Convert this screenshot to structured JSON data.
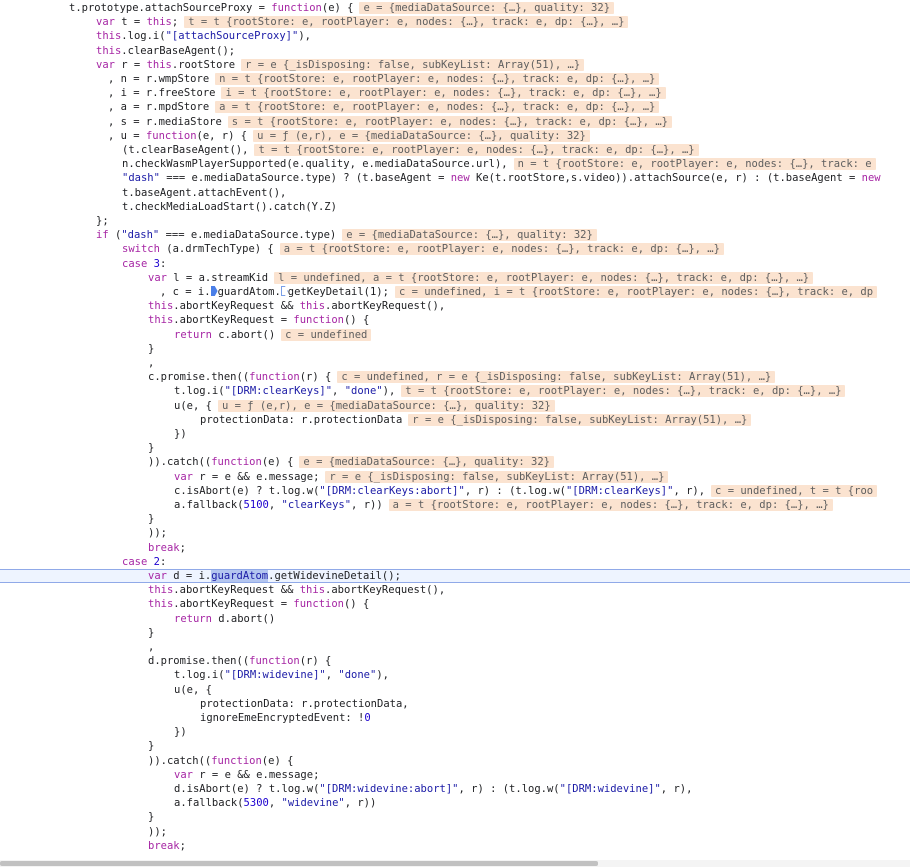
{
  "editor": {
    "lines": [
      {
        "indent": 69,
        "segs": [
          [
            "plain",
            "t.prototype.attachSourceProxy = "
          ],
          [
            "kw",
            "function"
          ],
          [
            "plain",
            "(e) {"
          ]
        ],
        "val": "e = {mediaDataSource: {…}, quality: 32}"
      },
      {
        "indent": 96,
        "segs": [
          [
            "kw",
            "var"
          ],
          [
            "plain",
            " t = "
          ],
          [
            "this",
            "this"
          ],
          [
            "plain",
            ";"
          ]
        ],
        "val": "t = t {rootStore: e, rootPlayer: e, nodes: {…}, track: e, dp: {…}, …}"
      },
      {
        "indent": 96,
        "segs": [
          [
            "this",
            "this"
          ],
          [
            "plain",
            ".log.i("
          ],
          [
            "str",
            "\"[attachSourceProxy]\""
          ],
          [
            "plain",
            "),"
          ]
        ]
      },
      {
        "indent": 96,
        "segs": [
          [
            "this",
            "this"
          ],
          [
            "plain",
            ".clearBaseAgent();"
          ]
        ]
      },
      {
        "indent": 96,
        "segs": [
          [
            "kw",
            "var"
          ],
          [
            "plain",
            " r = "
          ],
          [
            "this",
            "this"
          ],
          [
            "plain",
            ".rootStore"
          ]
        ],
        "val": "r = e {_isDisposing: false, subKeyList: Array(51), …}"
      },
      {
        "indent": 108,
        "segs": [
          [
            "plain",
            ", n = r.wmpStore"
          ]
        ],
        "val": "n = t {rootStore: e, rootPlayer: e, nodes: {…}, track: e, dp: {…}, …}"
      },
      {
        "indent": 108,
        "segs": [
          [
            "plain",
            ", i = r.freeStore"
          ]
        ],
        "val": "i = t {rootStore: e, rootPlayer: e, nodes: {…}, track: e, dp: {…}, …}"
      },
      {
        "indent": 108,
        "segs": [
          [
            "plain",
            ", a = r.mpdStore"
          ]
        ],
        "val": "a = t {rootStore: e, rootPlayer: e, nodes: {…}, track: e, dp: {…}, …}"
      },
      {
        "indent": 108,
        "segs": [
          [
            "plain",
            ", s = r.mediaStore"
          ]
        ],
        "val": "s = t {rootStore: e, rootPlayer: e, nodes: {…}, track: e, dp: {…}, …}"
      },
      {
        "indent": 108,
        "segs": [
          [
            "plain",
            ", u = "
          ],
          [
            "kw",
            "function"
          ],
          [
            "plain",
            "(e, r) {"
          ]
        ],
        "val": "u = ƒ (e,r), e = {mediaDataSource: {…}, quality: 32}"
      },
      {
        "indent": 122,
        "segs": [
          [
            "plain",
            "(t.clearBaseAgent(),"
          ]
        ],
        "val": "t = t {rootStore: e, rootPlayer: e, nodes: {…}, track: e, dp: {…}, …}"
      },
      {
        "indent": 122,
        "segs": [
          [
            "plain",
            "n.checkWasmPlayerSupported(e.quality, e.mediaDataSource.url),"
          ]
        ],
        "val": "n = t {rootStore: e, rootPlayer: e, nodes: {…}, track: e"
      },
      {
        "indent": 122,
        "segs": [
          [
            "str",
            "\"dash\""
          ],
          [
            "plain",
            " === e.mediaDataSource.type) ? (t.baseAgent = "
          ],
          [
            "kw",
            "new"
          ],
          [
            "plain",
            " Ke(t.rootStore,s.video)).attachSource(e, r) : (t.baseAgent = "
          ],
          [
            "kw",
            "new"
          ]
        ]
      },
      {
        "indent": 122,
        "segs": [
          [
            "plain",
            "t.baseAgent.attachEvent(),"
          ]
        ]
      },
      {
        "indent": 122,
        "segs": [
          [
            "plain",
            "t.checkMediaLoadStart().catch(Y.Z)"
          ]
        ]
      },
      {
        "indent": 96,
        "segs": [
          [
            "plain",
            "};"
          ]
        ]
      },
      {
        "indent": 96,
        "segs": [
          [
            "kw",
            "if"
          ],
          [
            "plain",
            " ("
          ],
          [
            "str",
            "\"dash\""
          ],
          [
            "plain",
            " === e.mediaDataSource.type)"
          ]
        ],
        "val": "e = {mediaDataSource: {…}, quality: 32}"
      },
      {
        "indent": 122,
        "segs": [
          [
            "kw",
            "switch"
          ],
          [
            "plain",
            " (a.drmTechType) {"
          ]
        ],
        "val": "a = t {rootStore: e, rootPlayer: e, nodes: {…}, track: e, dp: {…}, …}"
      },
      {
        "indent": 122,
        "segs": [
          [
            "kw",
            "case"
          ],
          [
            "plain",
            " "
          ],
          [
            "num",
            "3"
          ],
          [
            "plain",
            ":"
          ]
        ]
      },
      {
        "indent": 148,
        "segs": [
          [
            "kw",
            "var"
          ],
          [
            "plain",
            " l = a.streamKid"
          ]
        ],
        "val": "l = undefined, a = t {rootStore: e, rootPlayer: e, nodes: {…}, track: e, dp: {…}, …}"
      },
      {
        "indent": 160,
        "segs": [
          [
            "plain",
            ", c = i."
          ],
          [
            "bp",
            "filled"
          ],
          [
            "plain",
            "guardAtom."
          ],
          [
            "bp",
            "outline"
          ],
          [
            "plain",
            "getKeyDetail(1);"
          ]
        ],
        "val": "c = undefined, i = t {rootStore: e, rootPlayer: e, nodes: {…}, track: e, dp"
      },
      {
        "indent": 148,
        "segs": [
          [
            "this",
            "this"
          ],
          [
            "plain",
            ".abortKeyRequest && "
          ],
          [
            "this",
            "this"
          ],
          [
            "plain",
            ".abortKeyRequest(),"
          ]
        ]
      },
      {
        "indent": 148,
        "segs": [
          [
            "this",
            "this"
          ],
          [
            "plain",
            ".abortKeyRequest = "
          ],
          [
            "kw",
            "function"
          ],
          [
            "plain",
            "() {"
          ]
        ]
      },
      {
        "indent": 174,
        "segs": [
          [
            "kw",
            "return"
          ],
          [
            "plain",
            " c.abort()"
          ]
        ],
        "val": "c = undefined"
      },
      {
        "indent": 148,
        "segs": [
          [
            "plain",
            "}"
          ]
        ]
      },
      {
        "indent": 148,
        "segs": [
          [
            "plain",
            ","
          ]
        ]
      },
      {
        "indent": 148,
        "segs": [
          [
            "plain",
            "c.promise.then(("
          ],
          [
            "kw",
            "function"
          ],
          [
            "plain",
            "(r) {"
          ]
        ],
        "val": "c = undefined, r = e {_isDisposing: false, subKeyList: Array(51), …}"
      },
      {
        "indent": 174,
        "segs": [
          [
            "plain",
            "t.log.i("
          ],
          [
            "str",
            "\"[DRM:clearKeys]\""
          ],
          [
            "plain",
            ", "
          ],
          [
            "str",
            "\"done\""
          ],
          [
            "plain",
            "),"
          ]
        ],
        "val": "t = t {rootStore: e, rootPlayer: e, nodes: {…}, track: e, dp: {…}, …}"
      },
      {
        "indent": 174,
        "segs": [
          [
            "plain",
            "u(e, {"
          ]
        ],
        "val": "u = ƒ (e,r), e = {mediaDataSource: {…}, quality: 32}"
      },
      {
        "indent": 200,
        "segs": [
          [
            "plain",
            "protectionData: r.protectionData"
          ]
        ],
        "val": "r = e {_isDisposing: false, subKeyList: Array(51), …}"
      },
      {
        "indent": 174,
        "segs": [
          [
            "plain",
            "})"
          ]
        ]
      },
      {
        "indent": 148,
        "segs": [
          [
            "plain",
            "}"
          ]
        ]
      },
      {
        "indent": 148,
        "segs": [
          [
            "plain",
            "))."
          ],
          [
            "plain",
            "catch(("
          ],
          [
            "kw",
            "function"
          ],
          [
            "plain",
            "(e) {"
          ]
        ],
        "val": "e = {mediaDataSource: {…}, quality: 32}"
      },
      {
        "indent": 174,
        "segs": [
          [
            "kw",
            "var"
          ],
          [
            "plain",
            " r = e && e.message;"
          ]
        ],
        "val": "r = e {_isDisposing: false, subKeyList: Array(51), …}"
      },
      {
        "indent": 174,
        "segs": [
          [
            "plain",
            "c.isAbort(e) ? t.log.w("
          ],
          [
            "str",
            "\"[DRM:clearKeys:abort]\""
          ],
          [
            "plain",
            ", r) : (t.log.w("
          ],
          [
            "str",
            "\"[DRM:clearKeys]\""
          ],
          [
            "plain",
            ", r),"
          ]
        ],
        "val": "c = undefined, t = t {roo"
      },
      {
        "indent": 174,
        "segs": [
          [
            "plain",
            "a.fallback("
          ],
          [
            "num",
            "5100"
          ],
          [
            "plain",
            ", "
          ],
          [
            "str",
            "\"clearKeys\""
          ],
          [
            "plain",
            ", r))"
          ]
        ],
        "val": "a = t {rootStore: e, rootPlayer: e, nodes: {…}, track: e, dp: {…}, …}"
      },
      {
        "indent": 148,
        "segs": [
          [
            "plain",
            "}"
          ]
        ]
      },
      {
        "indent": 148,
        "segs": [
          [
            "plain",
            "));"
          ]
        ]
      },
      {
        "indent": 148,
        "segs": [
          [
            "kw",
            "break"
          ],
          [
            "plain",
            ";"
          ]
        ]
      },
      {
        "indent": 122,
        "segs": [
          [
            "kw",
            "case"
          ],
          [
            "plain",
            " "
          ],
          [
            "num",
            "2"
          ],
          [
            "plain",
            ":"
          ]
        ]
      },
      {
        "indent": 148,
        "current": true,
        "segs": [
          [
            "kw",
            "var"
          ],
          [
            "plain",
            " d = i."
          ],
          [
            "sel",
            "guardAtom"
          ],
          [
            "plain",
            ".getWidevineDetail();"
          ]
        ]
      },
      {
        "indent": 148,
        "segs": [
          [
            "this",
            "this"
          ],
          [
            "plain",
            ".abortKeyRequest && "
          ],
          [
            "this",
            "this"
          ],
          [
            "plain",
            ".abortKeyRequest(),"
          ]
        ]
      },
      {
        "indent": 148,
        "segs": [
          [
            "this",
            "this"
          ],
          [
            "plain",
            ".abortKeyRequest = "
          ],
          [
            "kw",
            "function"
          ],
          [
            "plain",
            "() {"
          ]
        ]
      },
      {
        "indent": 174,
        "segs": [
          [
            "kw",
            "return"
          ],
          [
            "plain",
            " d.abort()"
          ]
        ]
      },
      {
        "indent": 148,
        "segs": [
          [
            "plain",
            "}"
          ]
        ]
      },
      {
        "indent": 148,
        "segs": [
          [
            "plain",
            ","
          ]
        ]
      },
      {
        "indent": 148,
        "segs": [
          [
            "plain",
            "d.promise.then(("
          ],
          [
            "kw",
            "function"
          ],
          [
            "plain",
            "(r) {"
          ]
        ]
      },
      {
        "indent": 174,
        "segs": [
          [
            "plain",
            "t.log.i("
          ],
          [
            "str",
            "\"[DRM:widevine]\""
          ],
          [
            "plain",
            ", "
          ],
          [
            "str",
            "\"done\""
          ],
          [
            "plain",
            "),"
          ]
        ]
      },
      {
        "indent": 174,
        "segs": [
          [
            "plain",
            "u(e, {"
          ]
        ]
      },
      {
        "indent": 200,
        "segs": [
          [
            "plain",
            "protectionData: r.protectionData,"
          ]
        ]
      },
      {
        "indent": 200,
        "segs": [
          [
            "plain",
            "ignoreEmeEncryptedEvent: !"
          ],
          [
            "num",
            "0"
          ]
        ]
      },
      {
        "indent": 174,
        "segs": [
          [
            "plain",
            "})"
          ]
        ]
      },
      {
        "indent": 148,
        "segs": [
          [
            "plain",
            "}"
          ]
        ]
      },
      {
        "indent": 148,
        "segs": [
          [
            "plain",
            ")).catch(("
          ],
          [
            "kw",
            "function"
          ],
          [
            "plain",
            "(e) {"
          ]
        ]
      },
      {
        "indent": 174,
        "segs": [
          [
            "kw",
            "var"
          ],
          [
            "plain",
            " r = e && e.message;"
          ]
        ]
      },
      {
        "indent": 174,
        "segs": [
          [
            "plain",
            "d.isAbort(e) ? t.log.w("
          ],
          [
            "str",
            "\"[DRM:widevine:abort]\""
          ],
          [
            "plain",
            ", r) : (t.log.w("
          ],
          [
            "str",
            "\"[DRM:widevine]\""
          ],
          [
            "plain",
            ", r),"
          ]
        ]
      },
      {
        "indent": 174,
        "segs": [
          [
            "plain",
            "a.fallback("
          ],
          [
            "num",
            "5300"
          ],
          [
            "plain",
            ", "
          ],
          [
            "str",
            "\"widevine\""
          ],
          [
            "plain",
            ", r))"
          ]
        ]
      },
      {
        "indent": 148,
        "segs": [
          [
            "plain",
            "}"
          ]
        ]
      },
      {
        "indent": 148,
        "segs": [
          [
            "plain",
            "));"
          ]
        ]
      },
      {
        "indent": 148,
        "segs": [
          [
            "kw",
            "break"
          ],
          [
            "plain",
            ";"
          ]
        ]
      }
    ]
  },
  "colors": {
    "keyword": "#a626a4",
    "string": "#1a1aa6",
    "inline_value_bg": "#fbe3d0",
    "current_line_bg": "#eef4ff",
    "selection_bg": "#b3c5f0"
  }
}
